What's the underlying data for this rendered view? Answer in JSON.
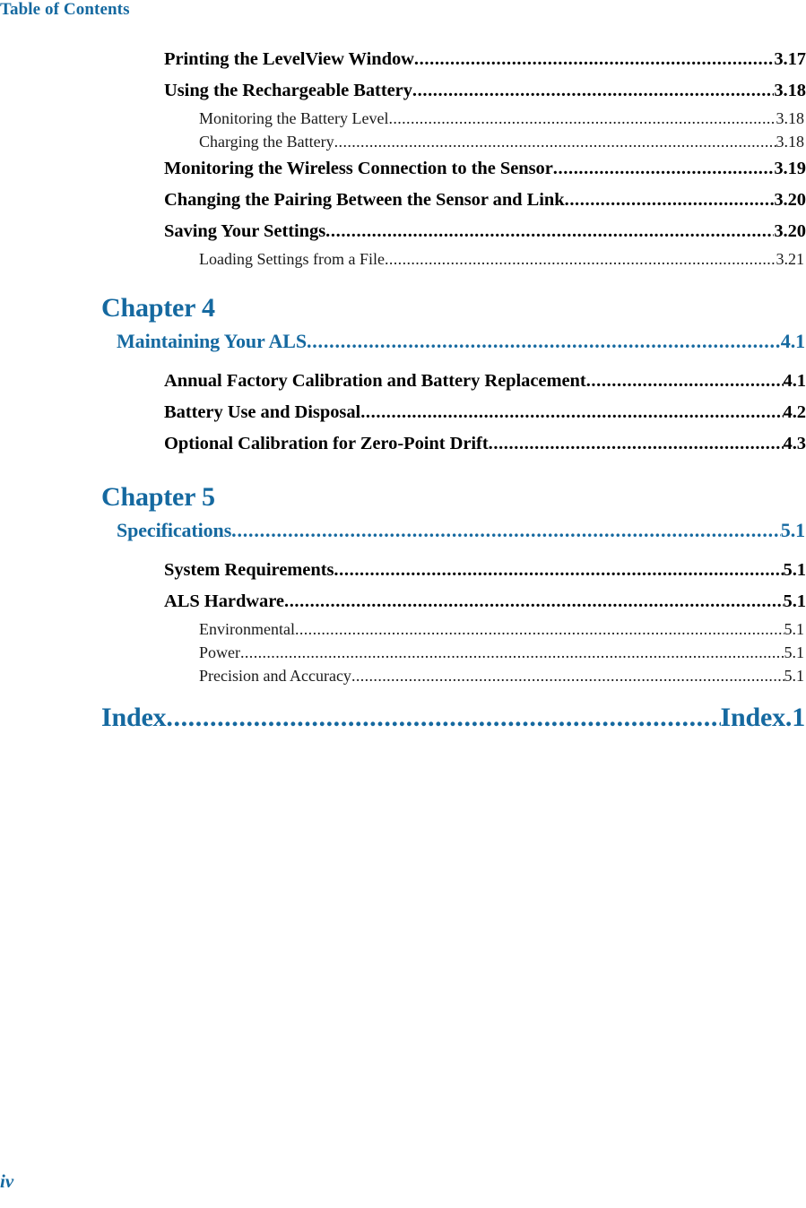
{
  "page": {
    "running_header": "Table of Contents",
    "folio": "iv",
    "accent_color": "#1569a0",
    "body_color": "#000000"
  },
  "toc": {
    "leader_dots": "................................................................................................................................................................................................",
    "sections": [
      {
        "type": "entries",
        "entries": [
          {
            "level": 1,
            "title": "Printing the LevelView Window",
            "page": "3.17"
          },
          {
            "level": 1,
            "title": "Using the Rechargeable Battery",
            "page": "3.18"
          },
          {
            "level": 2,
            "title": "Monitoring the Battery Level",
            "page": "3.18"
          },
          {
            "level": 2,
            "title": "Charging the Battery ",
            "page": "3.18"
          },
          {
            "level": 1,
            "title": "Monitoring the Wireless Connection to the Sensor ",
            "page": "3.19"
          },
          {
            "level": 1,
            "title": "Changing the Pairing Between the Sensor and Link",
            "page": "3.20"
          },
          {
            "level": 1,
            "title": "Saving Your Settings",
            "page": "3.20"
          },
          {
            "level": 2,
            "title": "Loading Settings from a File",
            "page": "3.21"
          }
        ]
      },
      {
        "type": "chapter",
        "chapter_label": "Chapter 4",
        "chapter_title": "Maintaining Your ALS",
        "chapter_page": "4.1",
        "entries": [
          {
            "level": 1,
            "title": "Annual Factory Calibration and Battery Replacement ",
            "page": "4.1"
          },
          {
            "level": 1,
            "title": "Battery Use and Disposal ",
            "page": "4.2"
          },
          {
            "level": 1,
            "title": "Optional Calibration for Zero-Point Drift ",
            "page": "4.3"
          }
        ]
      },
      {
        "type": "chapter",
        "chapter_label": "Chapter 5",
        "chapter_title": "Specifications",
        "chapter_page": "5.1",
        "entries": [
          {
            "level": 1,
            "title": "System Requirements ",
            "page": "5.1"
          },
          {
            "level": 1,
            "title": "ALS Hardware ",
            "page": "5.1"
          },
          {
            "level": 2,
            "title": "Environmental ",
            "page": "5.1"
          },
          {
            "level": 2,
            "title": "Power",
            "page": "5.1"
          },
          {
            "level": 2,
            "title": "Precision and Accuracy",
            "page": "5.1"
          }
        ]
      },
      {
        "type": "index",
        "index_title": "Index",
        "index_page": "Index.1"
      }
    ]
  }
}
